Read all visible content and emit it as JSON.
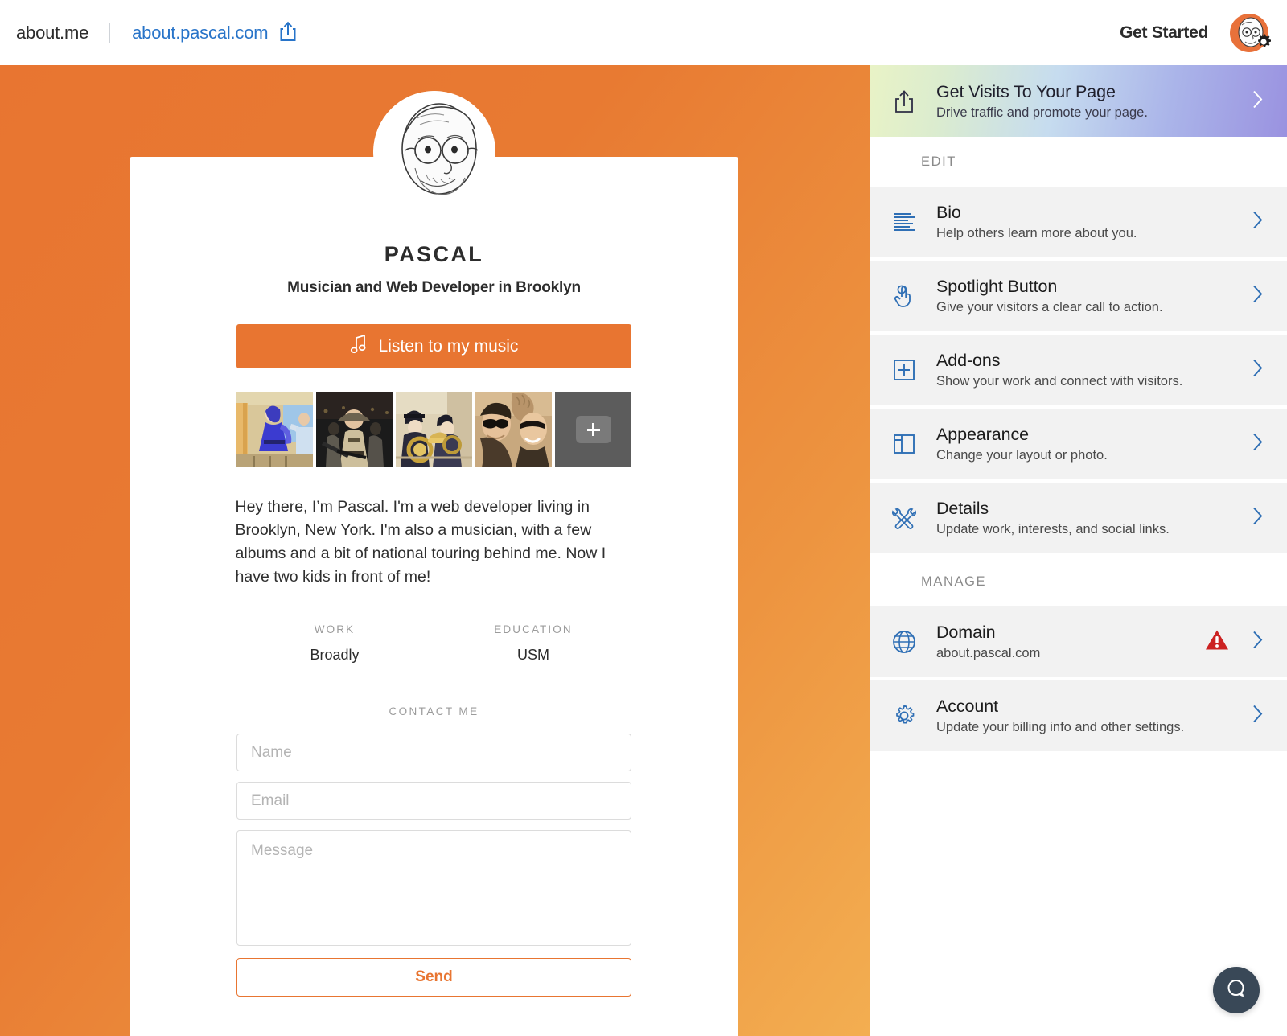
{
  "topbar": {
    "brand": "about.me",
    "domain_link": "about.pascal.com",
    "share_icon": "share-icon",
    "get_started": "Get Started",
    "avatar_icon": "user-avatar",
    "gear_icon": "gear-icon"
  },
  "profile": {
    "photo_icon": "profile-photo",
    "name": "PASCAL",
    "headline": "Musician and Web Developer in Brooklyn",
    "spotlight": {
      "label": "Listen to my music",
      "icon": "music-note-icon",
      "color": "#e87531"
    },
    "gallery": {
      "add_label": "+",
      "items": [
        {
          "name": "thumbnail-woman-in-blue"
        },
        {
          "name": "thumbnail-man-in-uniform"
        },
        {
          "name": "thumbnail-marching-band"
        },
        {
          "name": "thumbnail-couple-sunglasses"
        }
      ]
    },
    "bio": "Hey there, I’m Pascal. I'm a web developer living in Brooklyn, New York. I'm also a musician, with a few albums and a bit of national touring behind me. Now I have two kids in front of me!",
    "details": [
      {
        "label": "WORK",
        "value": "Broadly"
      },
      {
        "label": "EDUCATION",
        "value": "USM"
      }
    ],
    "contact": {
      "title": "CONTACT ME",
      "name_placeholder": "Name",
      "name_value": "",
      "email_placeholder": "Email",
      "email_value": "",
      "message_placeholder": "Message",
      "message_value": "",
      "send_label": "Send"
    },
    "background_color": "#e87531"
  },
  "sidebar": {
    "promo": {
      "title": "Get Visits To Your Page",
      "subtitle": "Drive traffic and promote your page.",
      "icon": "share-icon",
      "chevron": "chevron-right-icon"
    },
    "sections": [
      {
        "heading": "EDIT",
        "items": [
          {
            "title": "Bio",
            "subtitle": "Help others learn more about you.",
            "icon": "text-lines-icon",
            "warning": false
          },
          {
            "title": "Spotlight Button",
            "subtitle": "Give your visitors a clear call to action.",
            "icon": "pointing-hand-icon",
            "warning": false
          },
          {
            "title": "Add-ons",
            "subtitle": "Show your work and connect with visitors.",
            "icon": "plus-square-icon",
            "warning": false
          },
          {
            "title": "Appearance",
            "subtitle": "Change your layout or photo.",
            "icon": "layout-icon",
            "warning": false
          },
          {
            "title": "Details",
            "subtitle": "Update work, interests, and social links.",
            "icon": "tools-icon",
            "warning": false
          }
        ]
      },
      {
        "heading": "MANAGE",
        "items": [
          {
            "title": "Domain",
            "subtitle": "about.pascal.com",
            "icon": "globe-icon",
            "warning": true
          },
          {
            "title": "Account",
            "subtitle": "Update your billing info and other settings.",
            "icon": "gear-icon",
            "warning": false
          }
        ]
      }
    ],
    "accent_color": "#2f6fb5",
    "warning_color": "#cc2222"
  },
  "chat": {
    "icon": "chat-bubble-icon",
    "color": "#394857"
  }
}
